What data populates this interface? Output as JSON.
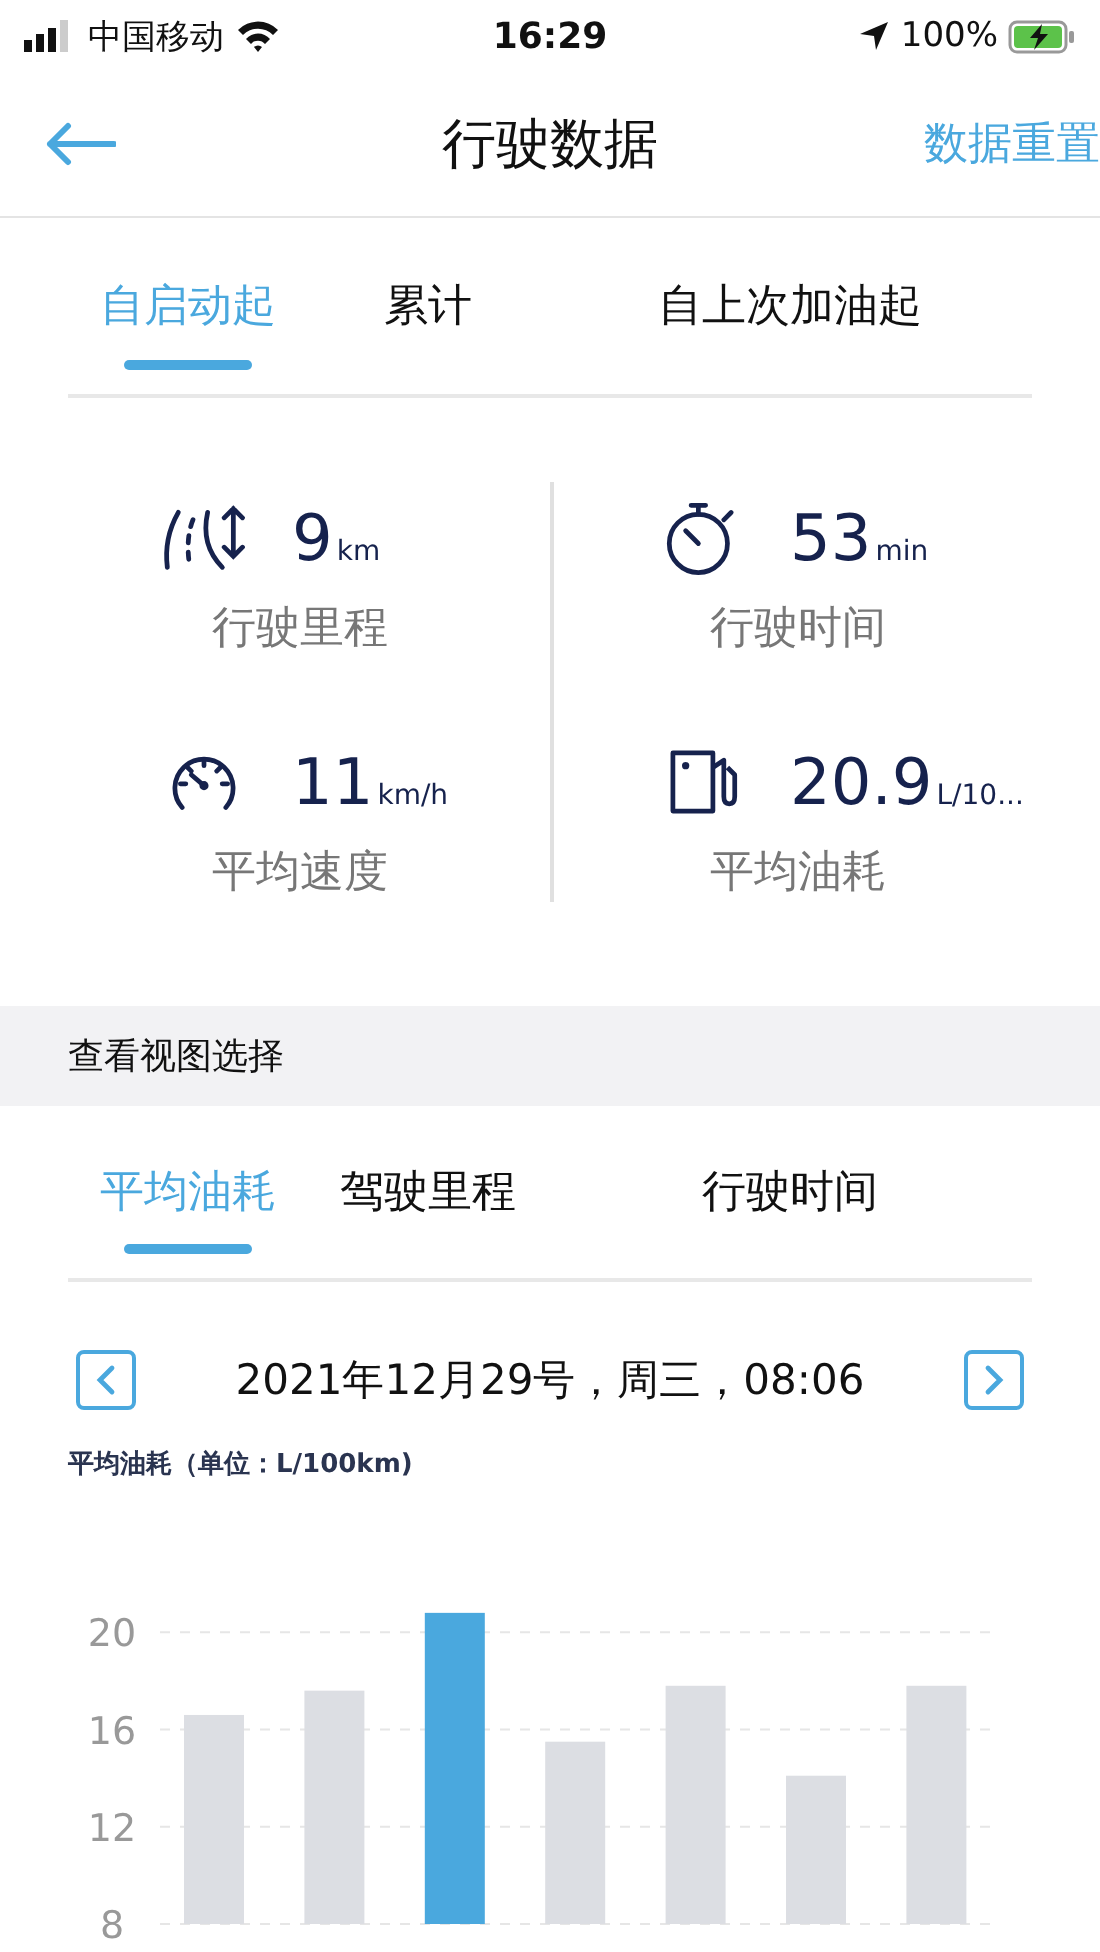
{
  "status_bar": {
    "carrier": "中国移动",
    "time": "16:29",
    "battery": "100%"
  },
  "nav": {
    "title": "行驶数据",
    "action": "数据重置"
  },
  "tabs": [
    {
      "label": "自启动起",
      "selected": true
    },
    {
      "label": "累计",
      "selected": false
    },
    {
      "label": "自上次加油起",
      "selected": false
    }
  ],
  "stats": [
    {
      "kind": "distance",
      "value": "9",
      "unit": "km",
      "label": "行驶里程"
    },
    {
      "kind": "time",
      "value": "53",
      "unit": "min",
      "label": "行驶时间"
    },
    {
      "kind": "speed",
      "value": "11",
      "unit": "km/h",
      "label": "平均速度"
    },
    {
      "kind": "fuel",
      "value": "20.9",
      "unit": "L/10...",
      "label": "平均油耗"
    }
  ],
  "view_section": {
    "title": "查看视图选择"
  },
  "view_tabs": [
    {
      "label": "平均油耗",
      "selected": true
    },
    {
      "label": "驾驶里程",
      "selected": false
    },
    {
      "label": "行驶时间",
      "selected": false
    }
  ],
  "date_nav": {
    "date": "2021年12月29号，周三，08:06"
  },
  "chart": {
    "chart_data": {
      "type": "bar",
      "ylabel": "平均油耗（单位：L/100km)",
      "grid": true,
      "series": [
        {
          "color": "#dcdee3",
          "values": [
            16.6,
            17.6,
            null,
            15.5,
            17.8,
            14.1,
            17.8
          ]
        },
        {
          "color": "#4aa8de",
          "values": [
            null,
            null,
            20.8,
            null,
            null,
            null,
            null
          ]
        }
      ],
      "yticks": [
        8,
        12,
        16,
        20
      ],
      "ylim": [
        8,
        21
      ]
    }
  }
}
